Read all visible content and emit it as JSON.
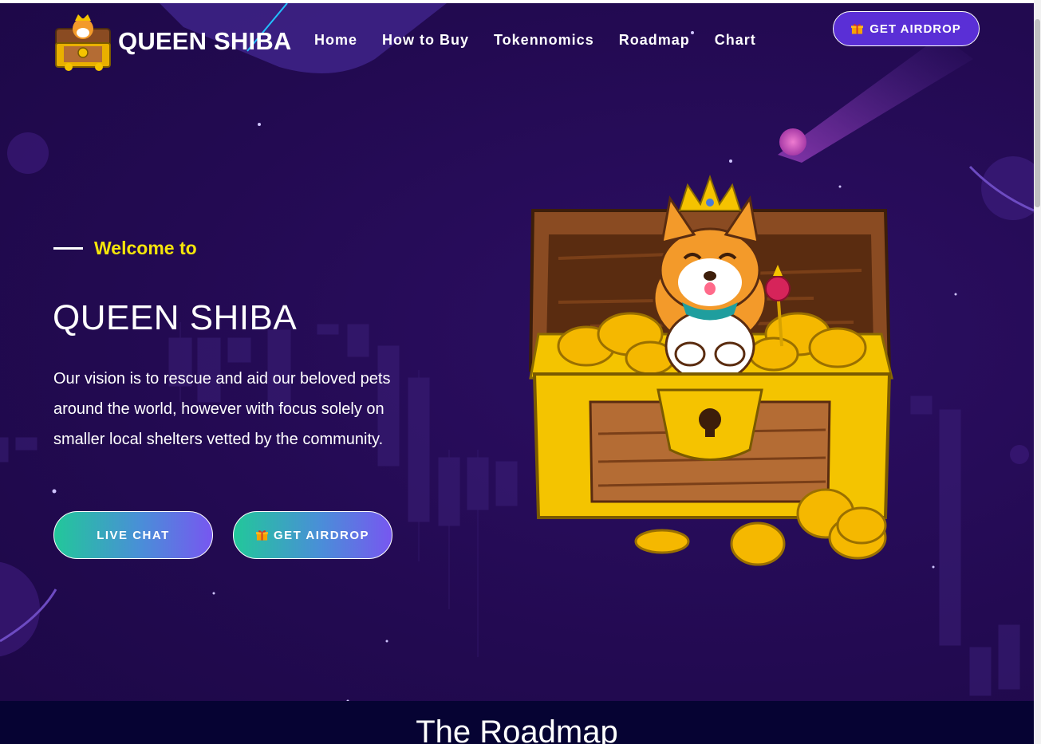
{
  "brand": {
    "name": "QUEEN SHIBA",
    "logo_icon": "treasure-chest-shiba-logo"
  },
  "nav": [
    {
      "label": "Home"
    },
    {
      "label": "How to Buy"
    },
    {
      "label": "Tokennomics"
    },
    {
      "label": "Roadmap"
    },
    {
      "label": "Chart"
    }
  ],
  "header_cta": {
    "label": "GET AIRDROP",
    "icon": "gift-icon"
  },
  "hero": {
    "welcome": "Welcome to",
    "title": "QUEEN SHIBA",
    "description": "Our vision is to rescue and aid our beloved pets around the world, however with focus solely on smaller local shelters vetted by the community.",
    "buttons": [
      {
        "label": "LIVE CHAT"
      },
      {
        "label": "GET AIRDROP",
        "icon": "gift-icon"
      }
    ],
    "illustration": "shiba-in-treasure-chest"
  },
  "roadmap": {
    "title": "The Roadmap"
  },
  "colors": {
    "background": "#230a52",
    "accent_yellow": "#f5e50a",
    "button_gradient_start": "#22c79a",
    "button_gradient_end": "#7757f0",
    "header_button": "#5a2fd6",
    "roadmap_band": "#060333"
  }
}
